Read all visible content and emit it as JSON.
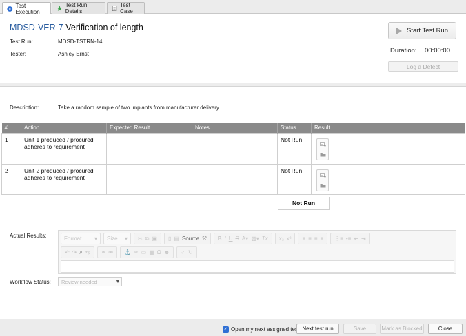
{
  "tabs": [
    {
      "label": "Test Execution",
      "icon": "play-circle-icon",
      "active": true
    },
    {
      "label": "Test Run Details",
      "icon": "star-icon",
      "active": false
    },
    {
      "label": "Test Case",
      "icon": "document-icon",
      "active": false
    }
  ],
  "header": {
    "key": "MDSD-VER-7",
    "title": "Verification of length",
    "test_run_label": "Test Run:",
    "test_run_value": "MDSD-TSTRN-14",
    "tester_label": "Tester:",
    "tester_value": "Ashley Ernst",
    "start_button": "Start Test Run",
    "duration_label": "Duration:",
    "duration_value": "00:00:00",
    "defect_button": "Log a Defect"
  },
  "description": {
    "label": "Description:",
    "value": "Take a random sample of two implants from manufacturer delivery."
  },
  "table": {
    "columns": [
      "#",
      "Action",
      "Expected Result",
      "Notes",
      "Status",
      "Result"
    ],
    "rows": [
      {
        "num": "1",
        "action": "Unit 1 produced / procured adheres to requirement",
        "expected": "",
        "notes": "",
        "status": "Not Run"
      },
      {
        "num": "2",
        "action": "Unit 2 produced / procured adheres to requirement",
        "expected": "",
        "notes": "",
        "status": "Not Run"
      }
    ],
    "overall_status": "Not Run"
  },
  "editor": {
    "label": "Actual Results:",
    "format_placeholder": "Format",
    "size_placeholder": "Size",
    "source_label": "Source"
  },
  "workflow": {
    "label": "Workflow Status:",
    "value": "Review needed"
  },
  "footer": {
    "checkbox_label": "Open my next assigned test",
    "checkbox_checked": true,
    "next_button": "Next test run",
    "save_button": "Save",
    "blocked_button": "Mark as Blocked",
    "close_button": "Close"
  },
  "colors": {
    "title_key": "#2a5d9f",
    "table_header": "#8a8a8a",
    "checkbox": "#2f6fd4"
  }
}
